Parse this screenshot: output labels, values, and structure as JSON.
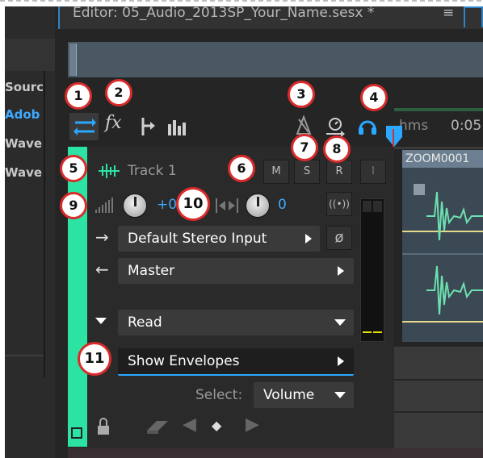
{
  "window": {
    "editor_title": "Editor: 05_Audio_2013SP_Your_Name.sesx *",
    "menu_icon": "menu-icon"
  },
  "left_panel": {
    "items": [
      "Sourc",
      "Adob",
      "Wave",
      "Wave"
    ]
  },
  "toolbar": {
    "icons": [
      "swap-io-icon",
      "fx-icon",
      "sends-icon",
      "eq-icon",
      "metronome-icon",
      "timer-icon",
      "headphones-icon"
    ]
  },
  "timeline": {
    "ruler_label": "hms",
    "time": "0:05"
  },
  "clip": {
    "name": "ZOOM0001"
  },
  "track": {
    "name": "Track 1",
    "buttons": [
      "M",
      "S",
      "R",
      "I"
    ],
    "volume_value": "+0",
    "pan_value": "0",
    "input": "Default Stereo Input",
    "output": "Master",
    "automation_mode": "Read",
    "envelopes_label": "Show Envelopes",
    "select_label": "Select:",
    "select_value": "Volume"
  },
  "callouts": [
    "1",
    "2",
    "3",
    "4",
    "5",
    "6",
    "7",
    "8",
    "9",
    "10",
    "11"
  ],
  "colors": {
    "accent_green": "#2ce3a4",
    "accent_blue": "#2b86c7",
    "callout_ring": "#d92b2b",
    "meter_level": "#e6e000"
  }
}
